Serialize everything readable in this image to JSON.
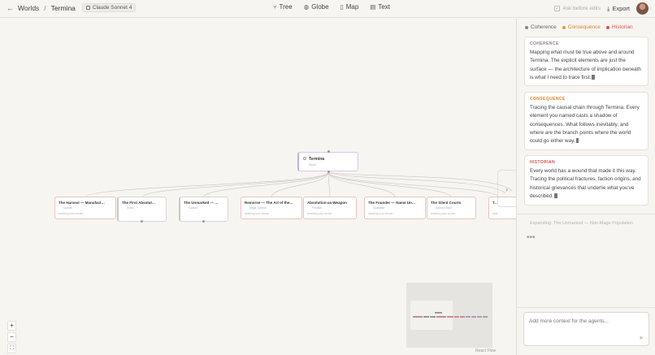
{
  "colors": {
    "coherence": "#8a8580",
    "consequence": "#e09a3e",
    "historian": "#d9534f",
    "node_border": "#e9c3c1"
  },
  "header": {
    "back_icon": "arrow-left-icon",
    "crumb_worlds": "Worlds",
    "crumb_sep": "/",
    "crumb_current": "Termina",
    "model": "Claude Sonnet 4",
    "views": [
      {
        "icon": "tree-icon",
        "glyph": "⑂",
        "label": "Tree"
      },
      {
        "icon": "globe-icon",
        "glyph": "◍",
        "label": "Globe"
      },
      {
        "icon": "map-icon",
        "glyph": "▯",
        "label": "Map"
      },
      {
        "icon": "text-icon",
        "glyph": "▤",
        "label": "Text"
      }
    ],
    "ask_before_edits": "Ask before edits",
    "export": "Export"
  },
  "tree": {
    "root": {
      "title": "Termina",
      "subtitle": "World"
    },
    "nodes": [
      {
        "title": "The Harvest — Manufact…",
        "subtitle": "Culture",
        "status": "Awaiting your choice"
      },
      {
        "title": "The First Absolut…",
        "subtitle": "Event",
        "status": ""
      },
      {
        "title": "The Unmarked — …",
        "subtitle": "Faction",
        "status": ""
      },
      {
        "title": "Remorse — The Art of the…",
        "subtitle": "Magic System",
        "status": "Awaiting your choice"
      },
      {
        "title": "Absolution-as-Weapon",
        "subtitle": "Practice",
        "status": "Awaiting your choice"
      },
      {
        "title": "The Founder — Name Un…",
        "subtitle": "Character",
        "status": "Awaiting your choice"
      },
      {
        "title": "The Silent Courts",
        "subtitle": "Sacred Order",
        "status": "Awaiting your choice"
      },
      {
        "title": "T…",
        "subtitle": "",
        "status": "Awa…"
      }
    ],
    "zoom_in": "+",
    "zoom_out": "−",
    "fit": "⛶",
    "lock": "🔒",
    "attribution": "React Flow"
  },
  "panel": {
    "legend": [
      {
        "label": "Coherence",
        "color": "#8a8580"
      },
      {
        "label": "Consequence",
        "color": "#e09a3e"
      },
      {
        "label": "Historian",
        "color": "#d9534f"
      }
    ],
    "cards": [
      {
        "label": "COHERENCE",
        "color": "#8a8580",
        "text": "Mapping what must be true above and around Termina. The explicit elements are just the surface — the architecture of implication beneath is what I need to trace first."
      },
      {
        "label": "CONSEQUENCE",
        "color": "#d9822b",
        "text": "Tracing the causal chain through Termina. Every element you named casts a shadow of consequences. What follows inevitably, and where are the branch points where the world could go either way."
      },
      {
        "label": "HISTORIAN",
        "color": "#d9534f",
        "text": "Every world has a wound that made it this way. Tracing the political fractures, faction origins, and historical grievances that underlie what you've described."
      }
    ],
    "expanding": "Expanding: The Unmarked — Non-Mage Population",
    "loading": "•••",
    "input_placeholder": "Add more context for the agents..."
  }
}
